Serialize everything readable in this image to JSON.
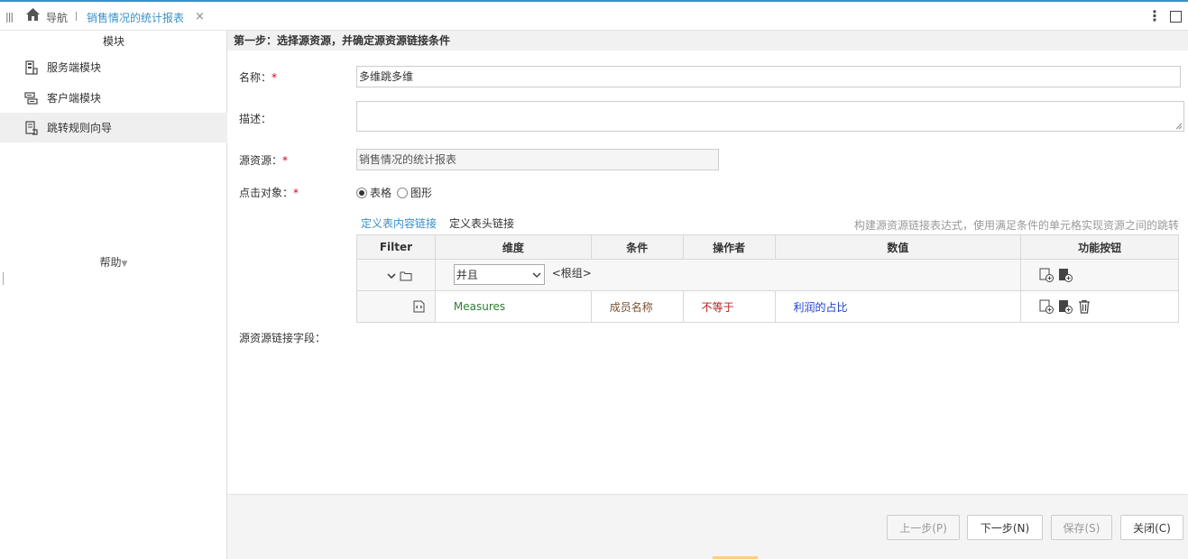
{
  "topbar": {
    "home_label": "导航",
    "tab_title": "销售情况的统计报表",
    "tab_close": "×",
    "more": "⋮"
  },
  "sidebar": {
    "title": "模块",
    "items": [
      {
        "label": "服务端模块",
        "icon": "server-module-icon"
      },
      {
        "label": "客户端模块",
        "icon": "client-module-icon"
      },
      {
        "label": "跳转规则向导",
        "icon": "jump-rule-icon"
      }
    ],
    "help_label": "帮助"
  },
  "main": {
    "step_title": "第一步：选择源资源，并确定源资源链接条件",
    "form": {
      "name_label": "名称：",
      "name_value": "多维跳多维",
      "desc_label": "描述：",
      "desc_value": "",
      "source_label": "源资源：",
      "source_value": "销售情况的统计报表",
      "click_target_label": "点击对象：",
      "required_mark": "*",
      "radio_table": "表格",
      "radio_chart": "图形",
      "link_field_label": "源资源链接字段："
    },
    "tabs": [
      "定义表内容链接",
      "定义表头链接"
    ],
    "tab_hint": "构建源资源链接表达式，使用满足条件的单元格实现资源之间的跳转",
    "table": {
      "headers": [
        "Filter",
        "维度",
        "条件",
        "操作者",
        "数值",
        "功能按钮"
      ],
      "group_row": {
        "logic": "并且",
        "group_label": "<根组>"
      },
      "rows": [
        {
          "dimension": "Measures",
          "condition": "成员名称",
          "operator": "不等于",
          "value": "利润的占比"
        }
      ]
    }
  },
  "footer": {
    "prev": "上一步(P)",
    "next": "下一步(N)",
    "save": "保存(S)",
    "close": "关闭(C)"
  }
}
